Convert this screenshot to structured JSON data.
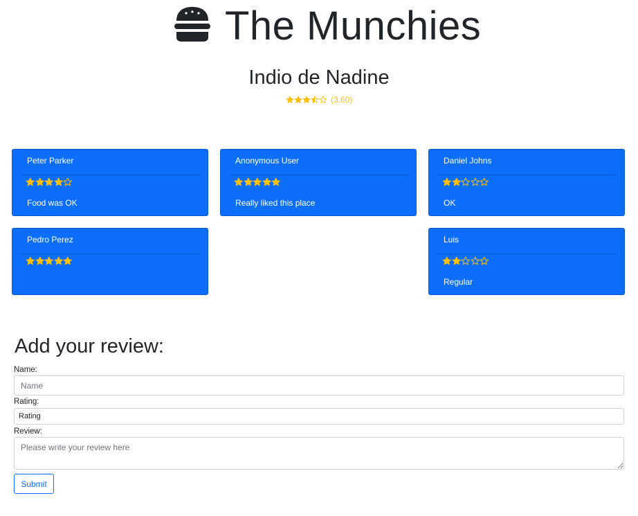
{
  "app": {
    "title": "The Munchies",
    "logo_icon": "hamburger-icon"
  },
  "restaurant": {
    "name": "Indio de Nadine",
    "rating": 3.6,
    "rating_text": "(3.60)"
  },
  "colors": {
    "card_bg": "#0d6efd",
    "star": "#ffc107",
    "text_dark": "#212529",
    "input_border": "#ced4da"
  },
  "reviews": [
    {
      "name": "Peter Parker",
      "rating": 4,
      "text": "Food was OK"
    },
    {
      "name": "Anonymous User",
      "rating": 5,
      "text": "Really liked this place"
    },
    {
      "name": "Daniel Johns",
      "rating": 2,
      "text": "OK"
    },
    {
      "name": "Pedro Perez",
      "rating": 5,
      "text": ""
    },
    {
      "name": "Luis",
      "rating": 2,
      "text": "Regular"
    }
  ],
  "form": {
    "title": "Add your review:",
    "name_label": "Name:",
    "name_placeholder": "Name",
    "rating_label": "Rating:",
    "rating_value": "Rating",
    "review_label": "Review:",
    "review_placeholder": "Please write your review here",
    "submit_label": "Submit"
  }
}
